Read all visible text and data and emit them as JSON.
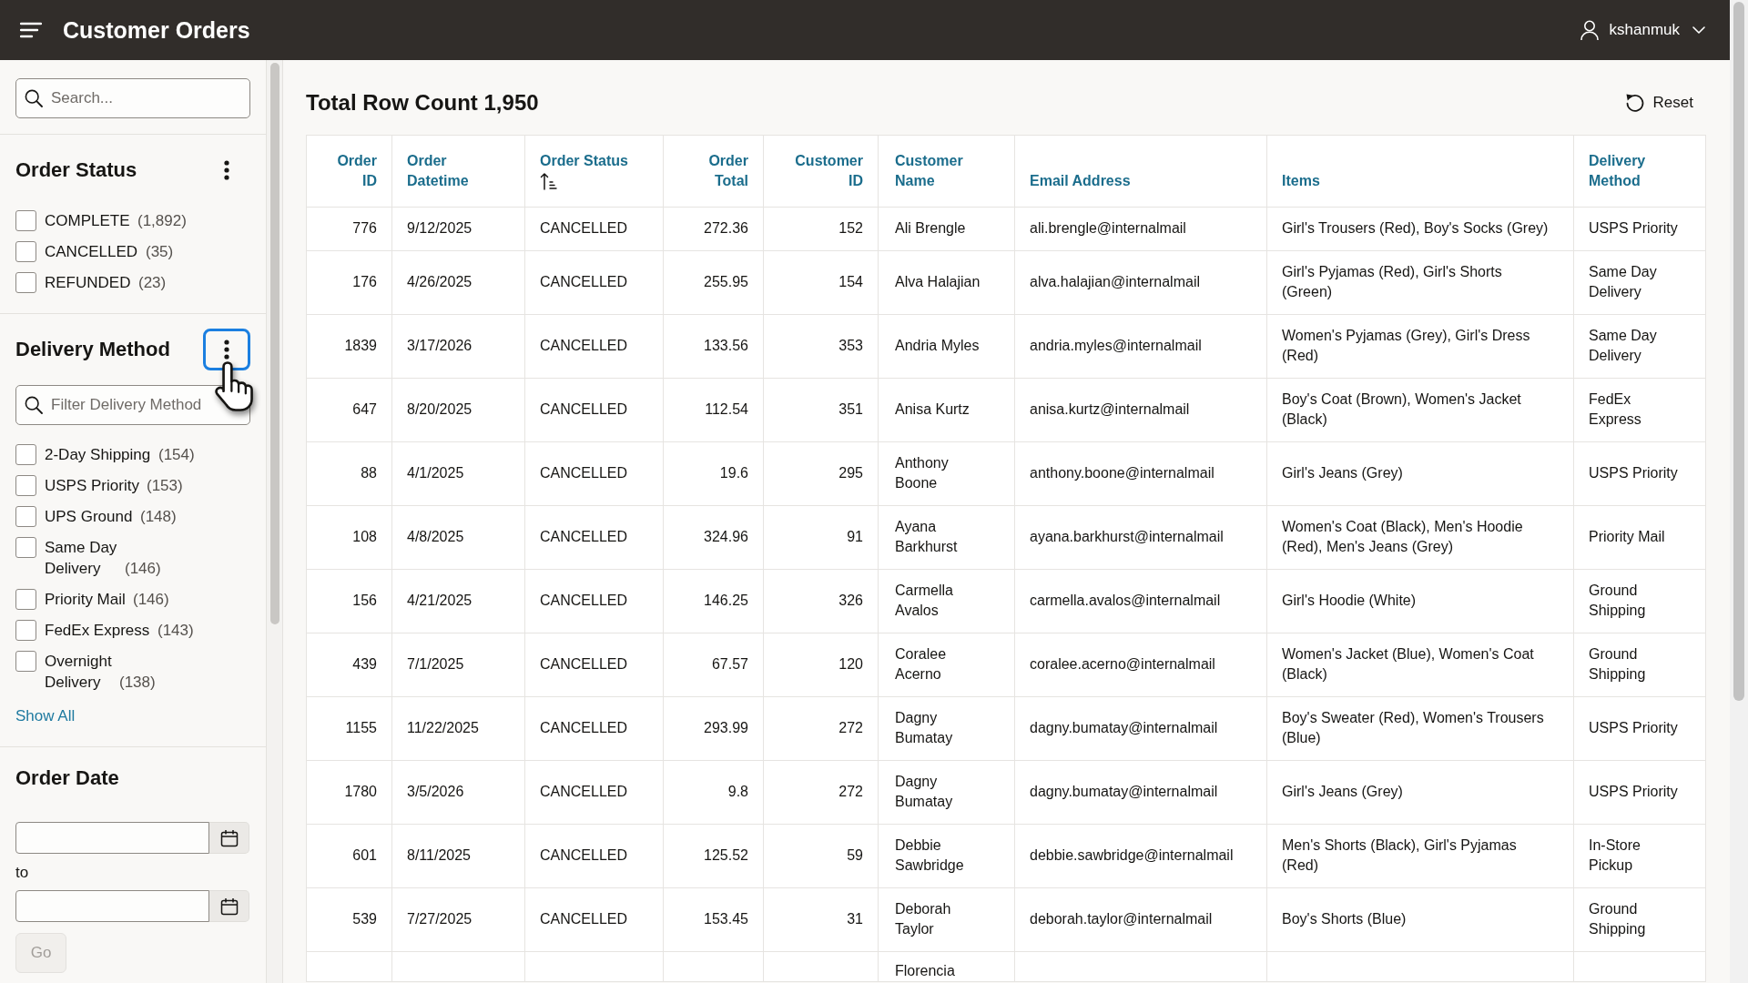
{
  "header": {
    "title": "Customer Orders",
    "user": {
      "name": "kshanmuk"
    }
  },
  "sidebar": {
    "search": {
      "placeholder": "Search..."
    },
    "facets": [
      {
        "kind": "checklist",
        "title": "Order Status",
        "menu": {
          "focused": false
        },
        "items": [
          {
            "label": "COMPLETE",
            "count": "(1,892)",
            "checked": false
          },
          {
            "label": "CANCELLED",
            "count": "(35)",
            "checked": false
          },
          {
            "label": "REFUNDED",
            "count": "(23)",
            "checked": false
          }
        ]
      },
      {
        "kind": "checklist",
        "title": "Delivery Method",
        "menu": {
          "focused": true
        },
        "filter": {
          "placeholder": "Filter Delivery Method"
        },
        "items": [
          {
            "label": "2-Day Shipping",
            "count": "(154)",
            "checked": false
          },
          {
            "label": "USPS Priority",
            "count": "(153)",
            "checked": false
          },
          {
            "label": "UPS Ground",
            "count": "(148)",
            "checked": false
          },
          {
            "label": "Same Day Delivery",
            "count": "(146)",
            "checked": false
          },
          {
            "label": "Priority Mail",
            "count": "(146)",
            "checked": false
          },
          {
            "label": "FedEx Express",
            "count": "(143)",
            "checked": false
          },
          {
            "label": "Overnight Delivery",
            "count": "(138)",
            "checked": false
          }
        ],
        "show_all": "Show All"
      },
      {
        "kind": "date_range",
        "title": "Order Date",
        "separator": "to",
        "button": {
          "label": "Go",
          "disabled": true
        }
      }
    ]
  },
  "report": {
    "title": "Total Row Count 1,950",
    "reset": "Reset",
    "table": {
      "columns": [
        {
          "label": "Order ID",
          "kind": "number",
          "sorted": false
        },
        {
          "label": "Order Datetime",
          "kind": "text",
          "sorted": false
        },
        {
          "label": "Order Status",
          "kind": "text",
          "sorted": true
        },
        {
          "label": "Order Total",
          "kind": "number",
          "sorted": false
        },
        {
          "label": "Customer ID",
          "kind": "number",
          "sorted": false
        },
        {
          "label": "Customer Name",
          "kind": "text",
          "sorted": false
        },
        {
          "label": "Email Address",
          "kind": "text",
          "sorted": false
        },
        {
          "label": "Items",
          "kind": "text",
          "sorted": false
        },
        {
          "label": "Delivery Method",
          "kind": "text",
          "sorted": false
        }
      ],
      "rows": [
        {
          "kind": "full",
          "cells": [
            "776",
            "9/12/2025",
            "CANCELLED",
            "272.36",
            "152",
            "Ali Brengle",
            "ali.brengle@internalmail",
            "Girl's Trousers (Red), Boy's Socks (Grey)",
            "USPS Priority"
          ]
        },
        {
          "kind": "full",
          "cells": [
            "176",
            "4/26/2025",
            "CANCELLED",
            "255.95",
            "154",
            "Alva Halajian",
            "alva.halajian@internalmail",
            "Girl's Pyjamas (Red), Girl's Shorts (Green)",
            "Same Day Delivery"
          ]
        },
        {
          "kind": "full",
          "cells": [
            "1839",
            "3/17/2026",
            "CANCELLED",
            "133.56",
            "353",
            "Andria Myles",
            "andria.myles@internalmail",
            "Women's Pyjamas (Grey), Girl's Dress (Red)",
            "Same Day Delivery"
          ]
        },
        {
          "kind": "full",
          "cells": [
            "647",
            "8/20/2025",
            "CANCELLED",
            "112.54",
            "351",
            "Anisa Kurtz",
            "anisa.kurtz@internalmail",
            "Boy's Coat (Brown), Women's Jacket (Black)",
            "FedEx Express"
          ]
        },
        {
          "kind": "full",
          "cells": [
            "88",
            "4/1/2025",
            "CANCELLED",
            "19.6",
            "295",
            "Anthony Boone",
            "anthony.boone@internalmail",
            "Girl's Jeans (Grey)",
            "USPS Priority"
          ]
        },
        {
          "kind": "full",
          "cells": [
            "108",
            "4/8/2025",
            "CANCELLED",
            "324.96",
            "91",
            "Ayana Barkhurst",
            "ayana.barkhurst@internalmail",
            "Women's Coat (Black), Men's Hoodie (Red), Men's Jeans (Grey)",
            "Priority Mail"
          ]
        },
        {
          "kind": "full",
          "cells": [
            "156",
            "4/21/2025",
            "CANCELLED",
            "146.25",
            "326",
            "Carmella Avalos",
            "carmella.avalos@internalmail",
            "Girl's Hoodie (White)",
            "Ground Shipping"
          ]
        },
        {
          "kind": "full",
          "cells": [
            "439",
            "7/1/2025",
            "CANCELLED",
            "67.57",
            "120",
            "Coralee Acerno",
            "coralee.acerno@internalmail",
            "Women's Jacket (Blue), Women's Coat (Black)",
            "Ground Shipping"
          ]
        },
        {
          "kind": "full",
          "cells": [
            "1155",
            "11/22/2025",
            "CANCELLED",
            "293.99",
            "272",
            "Dagny Bumatay",
            "dagny.bumatay@internalmail",
            "Boy's Sweater (Red), Women's Trousers (Blue)",
            "USPS Priority"
          ]
        },
        {
          "kind": "full",
          "cells": [
            "1780",
            "3/5/2026",
            "CANCELLED",
            "9.8",
            "272",
            "Dagny Bumatay",
            "dagny.bumatay@internalmail",
            "Girl's Jeans (Grey)",
            "USPS Priority"
          ]
        },
        {
          "kind": "full",
          "cells": [
            "601",
            "8/11/2025",
            "CANCELLED",
            "125.52",
            "59",
            "Debbie Sawbridge",
            "debbie.sawbridge@internalmail",
            "Men's Shorts (Black), Girl's Pyjamas (Red)",
            "In-Store Pickup"
          ]
        },
        {
          "kind": "full",
          "cells": [
            "539",
            "7/27/2025",
            "CANCELLED",
            "153.45",
            "31",
            "Deborah Taylor",
            "deborah.taylor@internalmail",
            "Boy's Shorts (Blue)",
            "Ground Shipping"
          ]
        },
        {
          "kind": "cut",
          "cells": [
            "",
            "",
            "",
            "",
            "",
            "Florencia"
          ]
        }
      ]
    }
  }
}
